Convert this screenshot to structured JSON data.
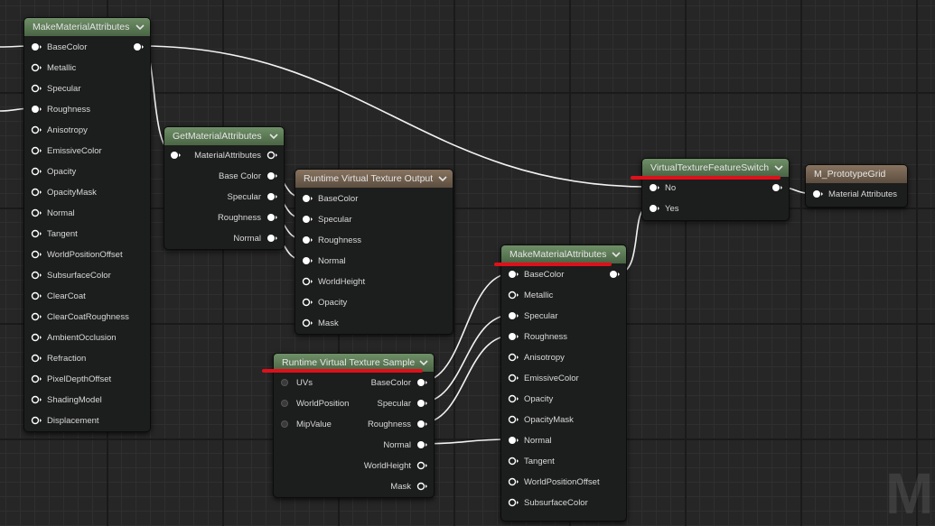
{
  "nodes": {
    "make1": {
      "title": "MakeMaterialAttributes",
      "out": "",
      "pins": [
        "BaseColor",
        "Metallic",
        "Specular",
        "Roughness",
        "Anisotropy",
        "EmissiveColor",
        "Opacity",
        "OpacityMask",
        "Normal",
        "Tangent",
        "WorldPositionOffset",
        "SubsurfaceColor",
        "ClearCoat",
        "ClearCoatRoughness",
        "AmbientOcclusion",
        "Refraction",
        "PixelDepthOffset",
        "ShadingModel",
        "Displacement"
      ]
    },
    "getattr": {
      "title": "GetMaterialAttributes",
      "in": "MaterialAttributes",
      "outs": [
        "Base Color",
        "Specular",
        "Roughness",
        "Normal"
      ]
    },
    "rvtOut": {
      "title": "Runtime Virtual Texture Output",
      "pins": [
        "BaseColor",
        "Specular",
        "Roughness",
        "Normal",
        "WorldHeight",
        "Opacity",
        "Mask"
      ]
    },
    "rvtSample": {
      "title": "Runtime Virtual Texture Sample",
      "ins": [
        "UVs",
        "WorldPosition",
        "MipValue"
      ],
      "outs": [
        "BaseColor",
        "Specular",
        "Roughness",
        "Normal",
        "WorldHeight",
        "Mask"
      ]
    },
    "switch": {
      "title": "VirtualTextureFeatureSwitch",
      "ins": [
        "No",
        "Yes"
      ]
    },
    "proto": {
      "title": "M_PrototypeGrid",
      "in": "Material Attributes"
    },
    "make2": {
      "title": "MakeMaterialAttributes",
      "pins": [
        "BaseColor",
        "Metallic",
        "Specular",
        "Roughness",
        "Anisotropy",
        "EmissiveColor",
        "Opacity",
        "OpacityMask",
        "Normal",
        "Tangent",
        "WorldPositionOffset",
        "SubsurfaceColor"
      ]
    }
  },
  "watermark": "MA",
  "colors": {
    "header_green": "#5b7a55",
    "header_brown": "#6e5e4f",
    "wire": "#f2f2f2",
    "highlight": "#e0101a"
  }
}
